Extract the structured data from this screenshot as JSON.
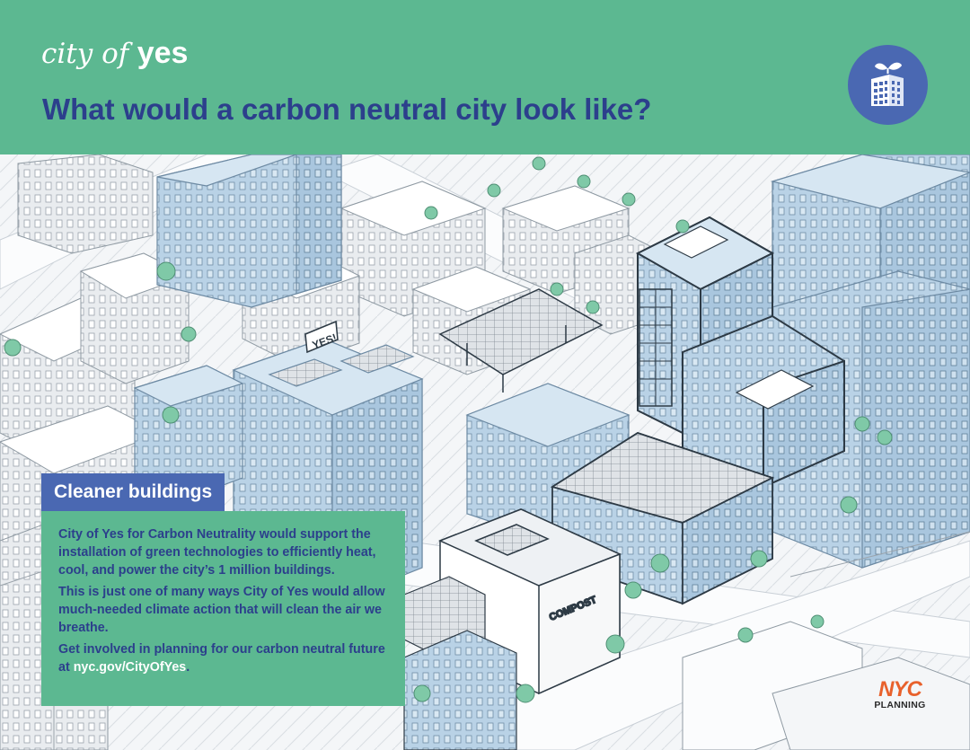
{
  "header": {
    "brand_light": "city of",
    "brand_bold": "yes",
    "headline": "What would a carbon neutral city look like?",
    "badge_icon": "green-building-icon",
    "background_color": "#5cb891",
    "headline_color": "#2c3f8c",
    "badge_color": "#4a68b2"
  },
  "illustration": {
    "sign_text": "YES!",
    "compost_text": "COMPOST"
  },
  "panel": {
    "title": "Cleaner buildings",
    "paragraph_1": "City of Yes for Carbon Neutrality would support the installation of green technologies to efficiently heat, cool, and power the city’s 1 million buildings.",
    "paragraph_2": "This is just one of many ways City of Yes would allow much-needed climate action that will clean the air we breathe.",
    "paragraph_3_prefix": "Get involved in planning for our carbon neutral future at ",
    "paragraph_3_link": "nyc.gov/CityOfYes",
    "paragraph_3_suffix": "."
  },
  "logo": {
    "line_1": "NYC",
    "line_2": "PLANNING",
    "color": "#e8612c"
  }
}
